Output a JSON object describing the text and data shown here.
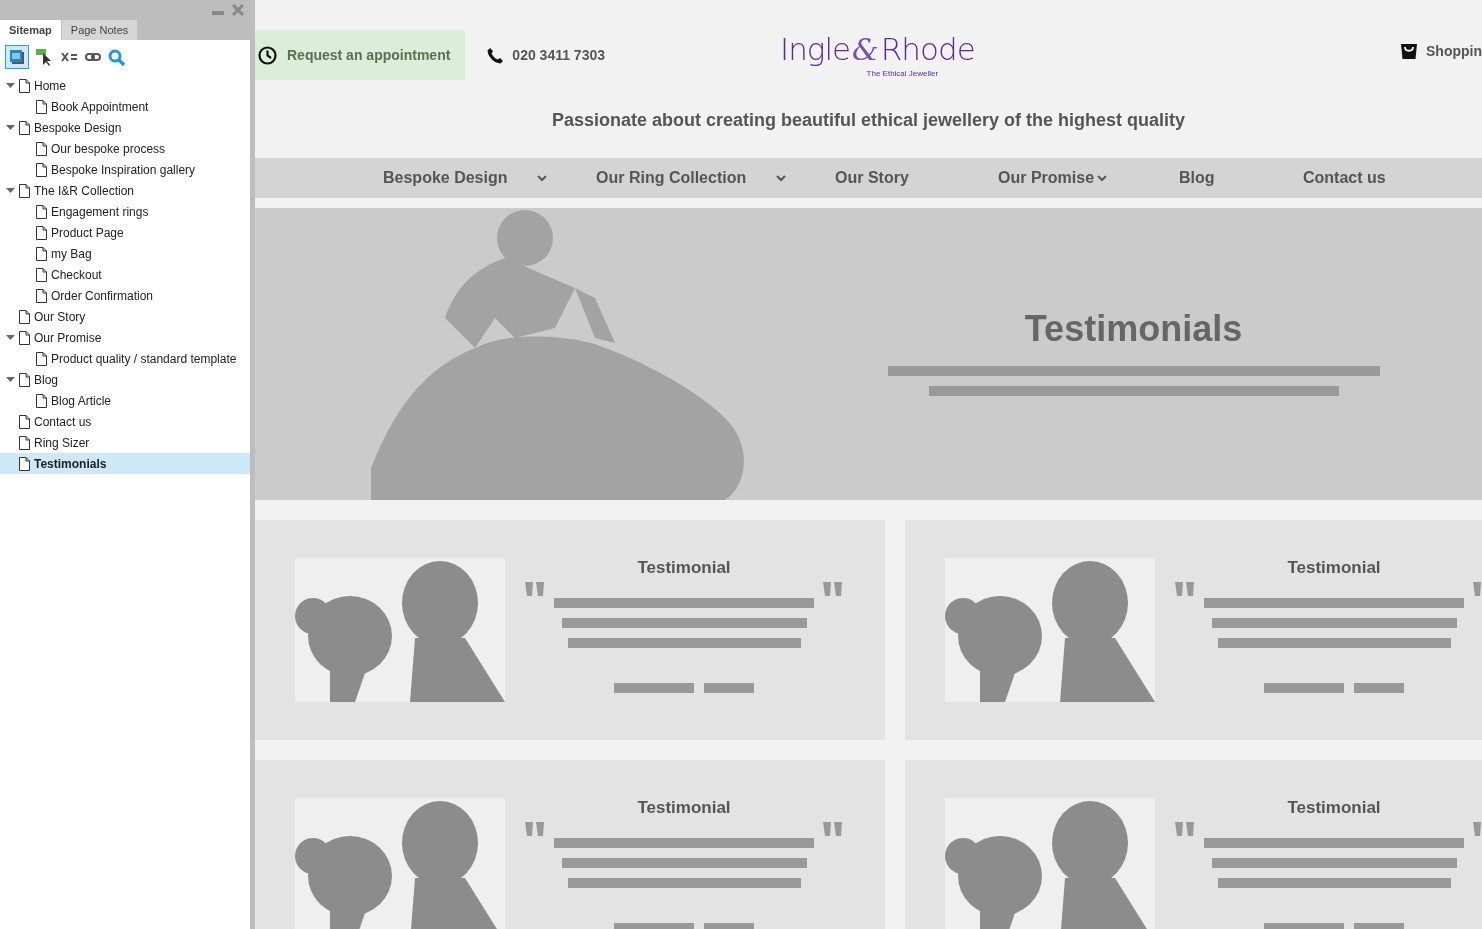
{
  "sidebar": {
    "tabs": [
      {
        "label": "Sitemap",
        "selected": true
      },
      {
        "label": "Page Notes",
        "selected": false
      }
    ],
    "tree": [
      {
        "label": "Home",
        "expanded": true,
        "selected": false,
        "children": [
          {
            "label": "Book Appointment",
            "selected": false
          }
        ]
      },
      {
        "label": "Bespoke Design",
        "expanded": true,
        "selected": false,
        "children": [
          {
            "label": "Our bespoke process",
            "selected": false
          },
          {
            "label": "Bespoke Inspiration gallery",
            "selected": false
          }
        ]
      },
      {
        "label": "The I&R Collection",
        "expanded": true,
        "selected": false,
        "children": [
          {
            "label": "Engagement rings",
            "selected": false
          },
          {
            "label": "Product Page",
            "selected": false
          },
          {
            "label": "my Bag",
            "selected": false
          },
          {
            "label": "Checkout",
            "selected": false
          },
          {
            "label": "Order Confirmation",
            "selected": false
          }
        ]
      },
      {
        "label": "Our Story",
        "selected": false
      },
      {
        "label": "Our Promise",
        "expanded": true,
        "selected": false,
        "children": [
          {
            "label": "Product quality / standard template",
            "selected": false
          }
        ]
      },
      {
        "label": "Blog",
        "expanded": true,
        "selected": false,
        "children": [
          {
            "label": "Blog Article",
            "selected": false
          }
        ]
      },
      {
        "label": "Contact us",
        "selected": false
      },
      {
        "label": "Ring Sizer",
        "selected": false
      },
      {
        "label": "Testimonials",
        "selected": true
      }
    ]
  },
  "header": {
    "appointment_button": "Request an appointment",
    "phone": "020 3411 7303",
    "logo": {
      "first": "Ingle",
      "amp": "&",
      "second": "Rhode",
      "tagline": "The Ethical Jeweller"
    },
    "cart": "Shoppin"
  },
  "tagline": "Passionate about creating beautiful ethical jewellery of the highest quality",
  "nav": [
    {
      "label": "Bespoke Design",
      "dropdown": true
    },
    {
      "label": "Our Ring Collection",
      "dropdown": true
    },
    {
      "label": "Our Story",
      "dropdown": false
    },
    {
      "label": "Our Promise",
      "dropdown": true
    },
    {
      "label": "Blog",
      "dropdown": false
    },
    {
      "label": "Contact us",
      "dropdown": false
    }
  ],
  "hero": {
    "title": "Testimonials"
  },
  "testimonials": [
    {
      "title": "Testimonial"
    },
    {
      "title": "Testimonial"
    },
    {
      "title": "Testimonial"
    },
    {
      "title": "Testimonial"
    }
  ]
}
